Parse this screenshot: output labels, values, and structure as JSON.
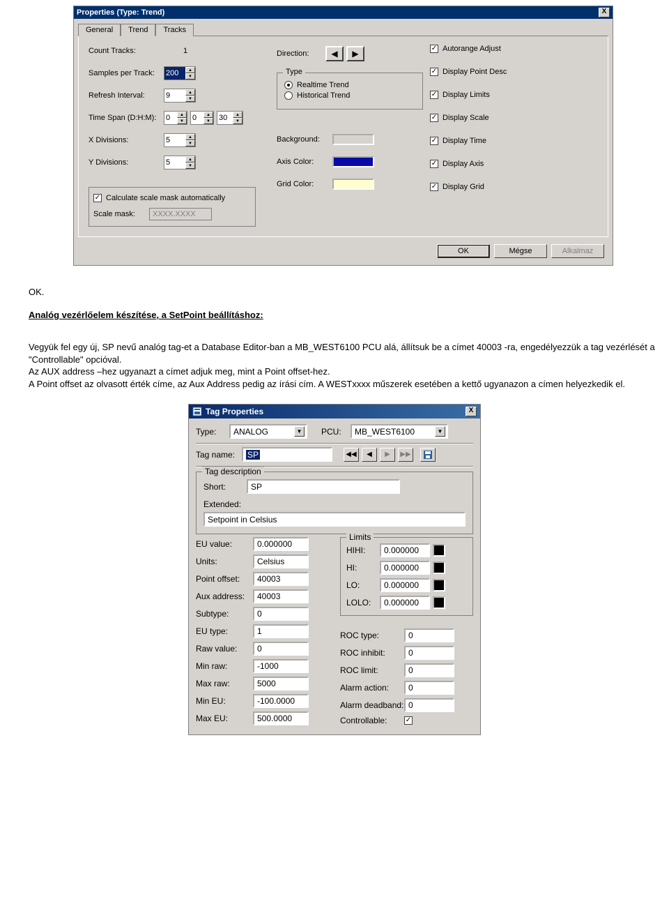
{
  "dialog1": {
    "title": "Properties (Type: Trend)",
    "close": "X",
    "tabs": {
      "general": "General",
      "trend": "Trend",
      "tracks": "Tracks"
    },
    "trend": {
      "countTracksLabel": "Count Tracks:",
      "countTracks": "1",
      "samplesLabel": "Samples per Track:",
      "samples": "200",
      "refreshLabel": "Refresh Interval:",
      "refresh": "9",
      "timespanLabel": "Time Span (D:H:M):",
      "timeD": "0",
      "timeH": "0",
      "timeM": "30",
      "xdivLabel": "X Divisions:",
      "xdiv": "5",
      "ydivLabel": "Y Divisions:",
      "ydiv": "5",
      "directionLabel": "Direction:",
      "typeLabel": "Type",
      "realtimeLabel": "Realtime Trend",
      "historicalLabel": "Historical Trend",
      "bgLabel": "Background:",
      "axisColorLabel": "Axis Color:",
      "gridColorLabel": "Grid Color:",
      "bgColor": "#d6d3ce",
      "axisColor": "#0909aa",
      "gridColor": "#fefecf",
      "autorangeLabel": "Autorange Adjust",
      "displayPointLabel": "Display Point Desc",
      "displayLimitsLabel": "Display Limits",
      "displayScaleLabel": "Display Scale",
      "displayTimeLabel": "Display Time",
      "displayAxisLabel": "Display Axis",
      "displayGridLabel": "Display Grid",
      "calcLabel": "Calculate scale mask automatically",
      "scalemaskLabel": "Scale mask:",
      "scalemask": "XXXX.XXXX"
    },
    "buttons": {
      "ok": "OK",
      "cancel": "Mégse",
      "apply": "Alkalmaz"
    }
  },
  "doc": {
    "ok": "OK.",
    "heading": "Analóg vezérlőelem készítése, a SetPoint beállításhoz:",
    "p1": "Vegyük fel egy új, SP nevű analóg tag-et a Database Editor-ban a MB_WEST6100 PCU alá, állítsuk be a címet 40003 -ra, engedélyezzük a tag vezérlését a \"Controllable\" opcióval.",
    "p2": "Az AUX address –hez ugyanazt a címet adjuk meg, mint a Point offset-hez.",
    "p3": "A Point offset az olvasott érték címe, az Aux Address pedig az írási cím. A WESTxxxx műszerek esetében a kettő ugyanazon a címen helyezkedik el."
  },
  "dialog2": {
    "title": "Tag Properties",
    "close": "X",
    "typeLabel": "Type:",
    "type": "ANALOG",
    "pcuLabel": "PCU:",
    "pcu": "MB_WEST6100",
    "tagnameLabel": "Tag name:",
    "tagname": "SP",
    "descLegend": "Tag description",
    "shortLabel": "Short:",
    "short": "SP",
    "extendedLabel": "Extended:",
    "extended": "Setpoint in Celsius",
    "left": {
      "euValueLabel": "EU value:",
      "euValue": "0.000000",
      "unitsLabel": "Units:",
      "units": "Celsius",
      "pointOffsetLabel": "Point offset:",
      "pointOffset": "40003",
      "auxLabel": "Aux address:",
      "aux": "40003",
      "subtypeLabel": "Subtype:",
      "subtype": "0",
      "euTypeLabel": "EU type:",
      "euType": "1",
      "rawLabel": "Raw value:",
      "raw": "0",
      "minrawLabel": "Min raw:",
      "minraw": "-1000",
      "maxrawLabel": "Max raw:",
      "maxraw": "5000",
      "mineuLabel": "Min EU:",
      "mineu": "-100.0000",
      "maxeuLabel": "Max EU:",
      "maxeu": "500.0000"
    },
    "limitsLegend": "Limits",
    "limits": {
      "hihiLabel": "HIHI:",
      "hihi": "0.000000",
      "hiLabel": "HI:",
      "hi": "0.000000",
      "loLabel": "LO:",
      "lo": "0.000000",
      "loloLabel": "LOLO:",
      "lolo": "0.000000"
    },
    "right": {
      "rocTypeLabel": "ROC type:",
      "rocType": "0",
      "rocInhibitLabel": "ROC inhibit:",
      "rocInhibit": "0",
      "rocLimitLabel": "ROC limit:",
      "rocLimit": "0",
      "alarmActionLabel": "Alarm action:",
      "alarmAction": "0",
      "alarmDeadbandLabel": "Alarm deadband:",
      "alarmDeadband": "0",
      "controllableLabel": "Controllable:"
    }
  }
}
